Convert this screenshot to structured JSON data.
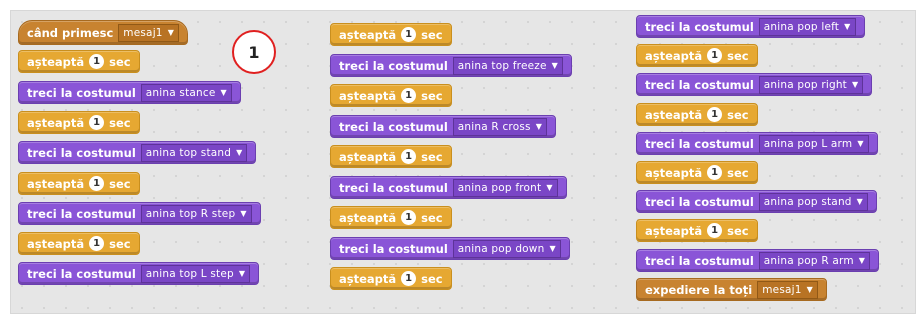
{
  "annotation": {
    "number": "1"
  },
  "columns": [
    {
      "blocks": [
        {
          "type": "event",
          "label": "când primesc",
          "value": "mesaj1"
        },
        {
          "type": "wait",
          "label": "așteaptă",
          "num": "1",
          "unit": "sec"
        },
        {
          "type": "look",
          "label": "treci la costumul",
          "value": "anina stance"
        },
        {
          "type": "wait",
          "label": "așteaptă",
          "num": "1",
          "unit": "sec"
        },
        {
          "type": "look",
          "label": "treci la costumul",
          "value": "anina top stand"
        },
        {
          "type": "wait",
          "label": "așteaptă",
          "num": "1",
          "unit": "sec"
        },
        {
          "type": "look",
          "label": "treci la costumul",
          "value": "anina top R step"
        },
        {
          "type": "wait",
          "label": "așteaptă",
          "num": "1",
          "unit": "sec"
        },
        {
          "type": "look",
          "label": "treci la costumul",
          "value": "anina top L step"
        }
      ]
    },
    {
      "blocks": [
        {
          "type": "wait",
          "label": "așteaptă",
          "num": "1",
          "unit": "sec"
        },
        {
          "type": "look",
          "label": "treci la costumul",
          "value": "anina top freeze"
        },
        {
          "type": "wait",
          "label": "așteaptă",
          "num": "1",
          "unit": "sec"
        },
        {
          "type": "look",
          "label": "treci la costumul",
          "value": "anina R cross"
        },
        {
          "type": "wait",
          "label": "așteaptă",
          "num": "1",
          "unit": "sec"
        },
        {
          "type": "look",
          "label": "treci la costumul",
          "value": "anina pop front"
        },
        {
          "type": "wait",
          "label": "așteaptă",
          "num": "1",
          "unit": "sec"
        },
        {
          "type": "look",
          "label": "treci la costumul",
          "value": "anina pop down"
        },
        {
          "type": "wait",
          "label": "așteaptă",
          "num": "1",
          "unit": "sec"
        }
      ]
    },
    {
      "blocks": [
        {
          "type": "look",
          "label": "treci la costumul",
          "value": "anina pop left"
        },
        {
          "type": "wait",
          "label": "așteaptă",
          "num": "1",
          "unit": "sec"
        },
        {
          "type": "look",
          "label": "treci la costumul",
          "value": "anina pop right"
        },
        {
          "type": "wait",
          "label": "așteaptă",
          "num": "1",
          "unit": "sec"
        },
        {
          "type": "look",
          "label": "treci la costumul",
          "value": "anina pop L arm"
        },
        {
          "type": "wait",
          "label": "așteaptă",
          "num": "1",
          "unit": "sec"
        },
        {
          "type": "look",
          "label": "treci la costumul",
          "value": "anina pop stand"
        },
        {
          "type": "wait",
          "label": "așteaptă",
          "num": "1",
          "unit": "sec"
        },
        {
          "type": "look",
          "label": "treci la costumul",
          "value": "anina pop R arm"
        },
        {
          "type": "event",
          "label": "expediere la toți",
          "value": "mesaj1"
        }
      ]
    }
  ],
  "colors": {
    "control": "#e6a832",
    "looks": "#8a55d7",
    "events": "#c88330",
    "annotation_ring": "#e02020"
  }
}
